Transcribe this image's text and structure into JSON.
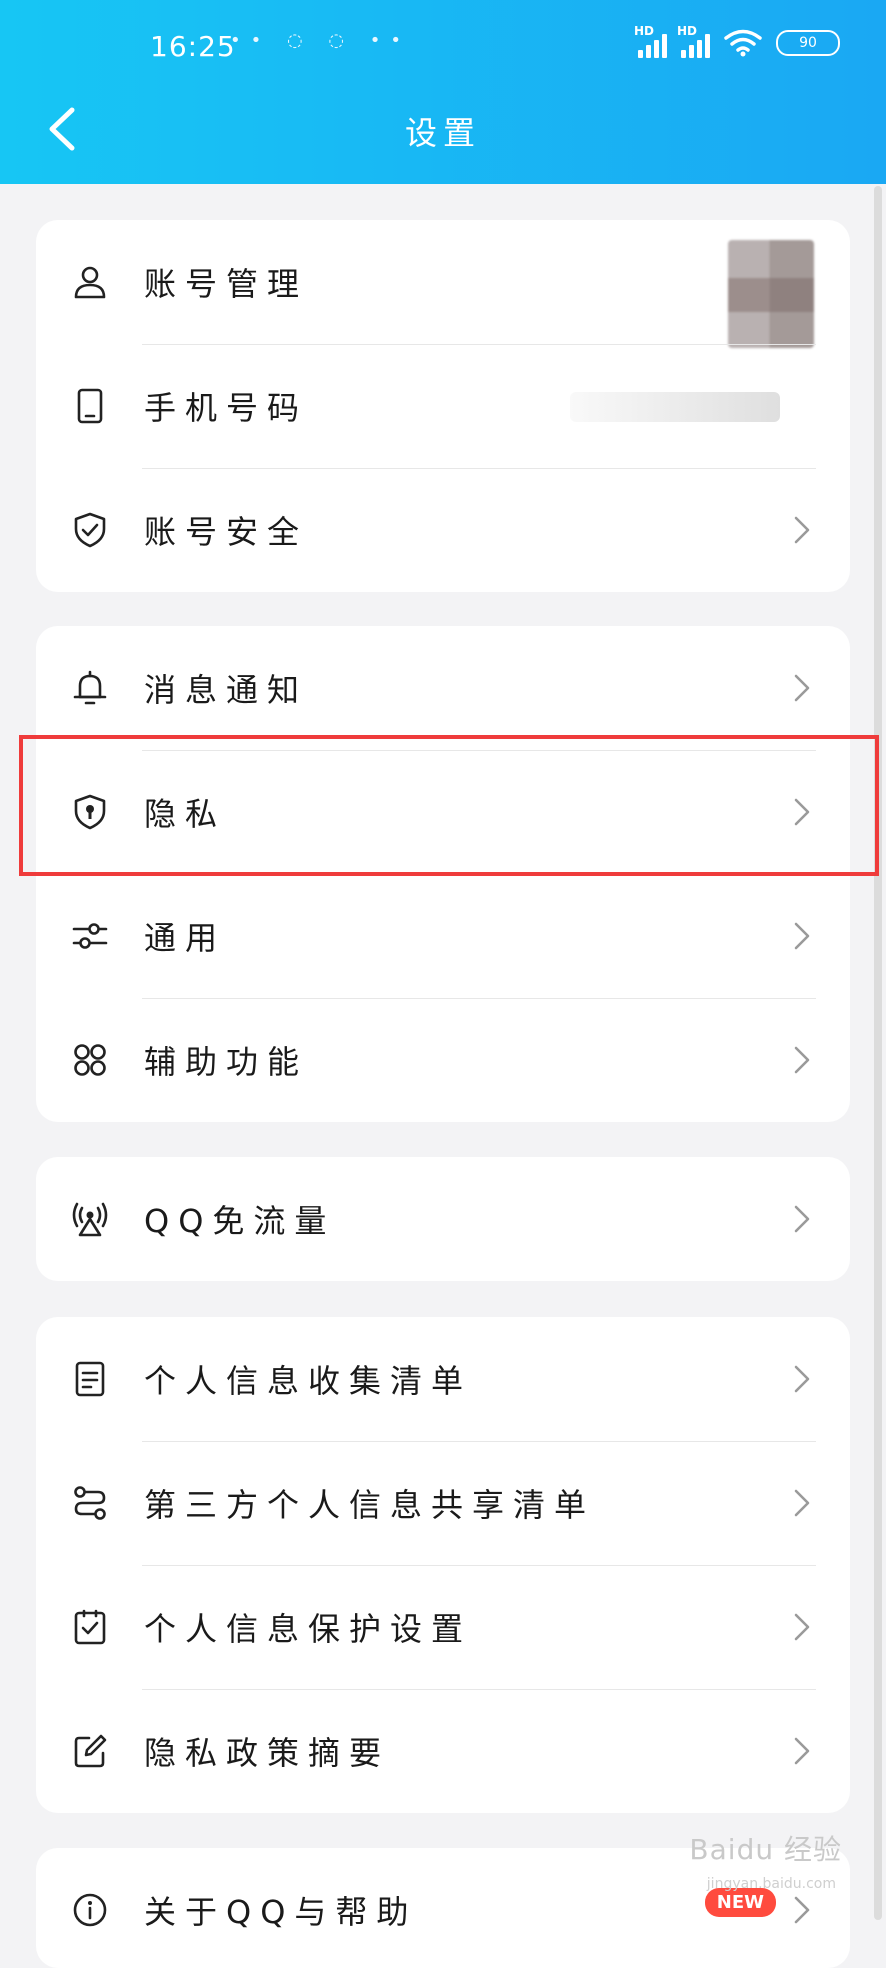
{
  "status_bar": {
    "time": "16:25",
    "dots": "•• ◌ ◌ ••",
    "battery": "90",
    "hd1": "HD",
    "hd2": "HD"
  },
  "header": {
    "title": "设置"
  },
  "groups": [
    {
      "items": [
        {
          "label": "账号管理",
          "icon": "person-icon"
        },
        {
          "label": "手机号码",
          "icon": "phone-icon"
        },
        {
          "label": "账号安全",
          "icon": "shield-check-icon"
        }
      ]
    },
    {
      "items": [
        {
          "label": "消息通知",
          "icon": "bell-icon"
        },
        {
          "label": "隐私",
          "icon": "shield-lock-icon"
        },
        {
          "label": "通用",
          "icon": "sliders-icon"
        },
        {
          "label": "辅助功能",
          "icon": "grid-icon"
        }
      ]
    },
    {
      "items": [
        {
          "label": "QQ免流量",
          "icon": "broadcast-icon"
        }
      ]
    },
    {
      "items": [
        {
          "label": "个人信息收集清单",
          "icon": "document-icon"
        },
        {
          "label": "第三方个人信息共享清单",
          "icon": "share-icon"
        },
        {
          "label": "个人信息保护设置",
          "icon": "checkbox-icon"
        },
        {
          "label": "隐私政策摘要",
          "icon": "edit-icon"
        }
      ]
    },
    {
      "items": [
        {
          "label": "关于QQ与帮助",
          "icon": "info-icon",
          "badge": "NEW"
        }
      ]
    }
  ],
  "watermark": {
    "main": "Baidu 经验",
    "sub": "jingyan.baidu.com"
  },
  "colors": {
    "header_start": "#17c6f4",
    "header_end": "#1aa8f3",
    "highlight": "#ef3b3b",
    "badge": "#ff4b3e"
  }
}
